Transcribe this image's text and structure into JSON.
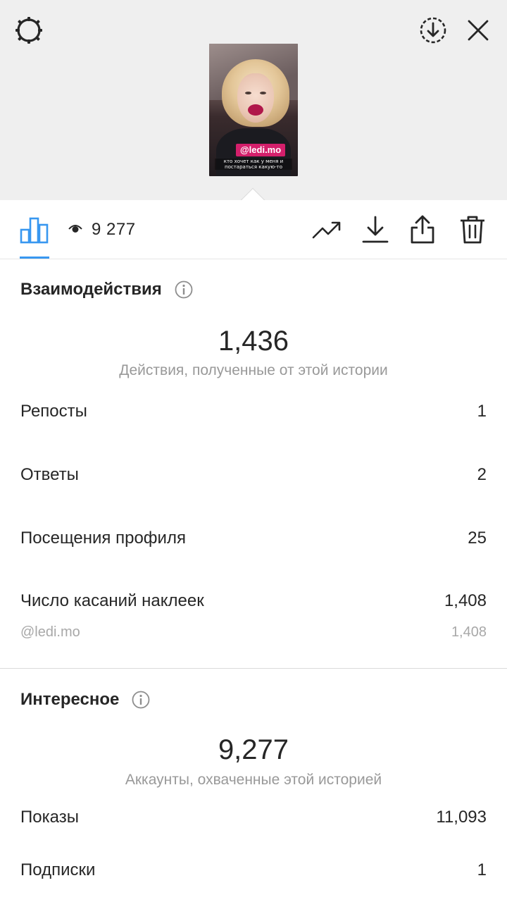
{
  "top": {
    "settings_icon": "settings-gear-icon",
    "archive_icon": "archive-download-icon",
    "close_icon": "close-icon",
    "thumbnail": {
      "sticker_label": "@ledi.mo",
      "caption": "кто хочет как у меня и постараться какую-то"
    }
  },
  "toolbar": {
    "insights_icon": "bar-chart-icon",
    "views_icon": "eye-icon",
    "views_count": "9 277",
    "promote_icon": "trending-up-icon",
    "download_icon": "download-icon",
    "share_icon": "share-icon",
    "delete_icon": "trash-icon"
  },
  "interactions": {
    "title": "Взаимодействия",
    "total": "1,436",
    "total_label": "Действия, полученные от этой истории",
    "rows": [
      {
        "label": "Репосты",
        "value": "1"
      },
      {
        "label": "Ответы",
        "value": "2"
      },
      {
        "label": "Посещения профиля",
        "value": "25"
      },
      {
        "label": "Число касаний наклеек",
        "value": "1,408"
      }
    ],
    "sticker_sub": {
      "label": "@ledi.mo",
      "value": "1,408"
    }
  },
  "discovery": {
    "title": "Интересное",
    "total": "9,277",
    "total_label": "Аккаунты, охваченные этой историей",
    "rows": [
      {
        "label": "Показы",
        "value": "11,093"
      },
      {
        "label": "Подписки",
        "value": "1"
      }
    ]
  },
  "colors": {
    "accent": "#3897f0",
    "text": "#262626",
    "muted": "#999999",
    "top_background": "#efefef"
  }
}
